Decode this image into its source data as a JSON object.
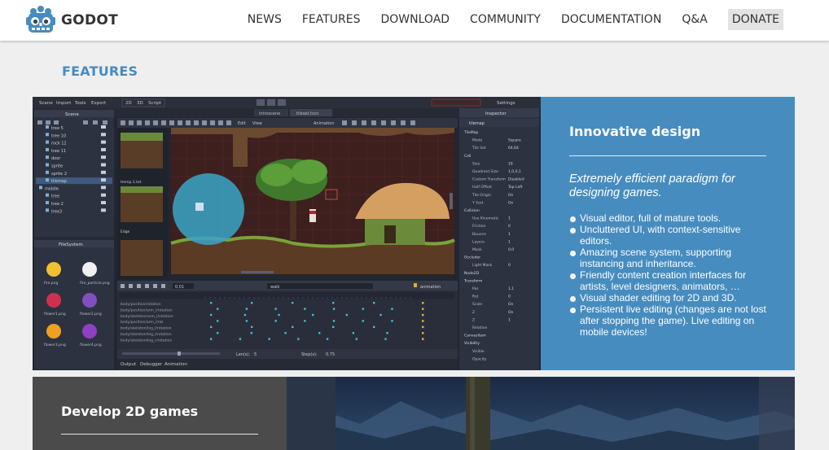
{
  "header": {
    "brand": "GODOT",
    "logo_icon": "godot-robot-logo-icon",
    "nav": [
      {
        "label": "NEWS"
      },
      {
        "label": "FEATURES"
      },
      {
        "label": "DOWNLOAD"
      },
      {
        "label": "COMMUNITY"
      },
      {
        "label": "DOCUMENTATION"
      },
      {
        "label": "Q&A"
      },
      {
        "label": "DONATE"
      }
    ]
  },
  "section": {
    "title": "FEATURES"
  },
  "feature1": {
    "title": "Innovative design",
    "tagline": "Extremely efficient paradigm for designing games.",
    "bullets": [
      "Visual editor, full of mature tools.",
      "Uncluttered UI, with context-sensitive editors.",
      "Amazing scene system, supporting instancing and inheritance.",
      "Friendly content creation interfaces for artists, level designers, animators, …",
      "Visual shader editing for 2D and 3D.",
      "Persistent live editing (changes are not lost after stopping the game). Live editing on mobile devices!"
    ],
    "screenshot": {
      "menu": [
        "Scene",
        "Import",
        "Tools",
        "Export"
      ],
      "modes": [
        "2D",
        "3D",
        "Script"
      ],
      "scene_tabs": [
        "introscene",
        "tileset.tscn"
      ],
      "settings": "Settings",
      "left_dock_title": "Scene",
      "tree": [
        "tree 5",
        "tree 10",
        "rock 12",
        "tree 11",
        "door",
        "sprite",
        "sprite 2",
        "tilemap",
        "middle",
        "tree",
        "tree 2",
        "tree3"
      ],
      "filesystem_title": "FileSystem",
      "files": [
        "fire.png",
        "fire_particle.png",
        "flower1.png",
        "flower2.png",
        "flower3.png",
        "flower4.png"
      ],
      "toolbar": [
        "Edit",
        "View",
        "Animation"
      ],
      "tile_labels": [
        "Hemp.1.tet",
        "Edge"
      ],
      "anim_toolbar": [
        "walk",
        "animation"
      ],
      "tracks": [
        "body/position/rotation",
        "body/position/arm_l/rotation",
        "body/skeleton/arm_l/rotation",
        "body/position/arm_l/rot",
        "body/skeleton/leg_l/rotation",
        "body/skeleton/leg_l/rotation",
        "body/skeleton/leg_r/rotation"
      ],
      "bottom_tabs": [
        "Output",
        "Debugger",
        "Animation"
      ],
      "len_label": "Len(s):",
      "len_value": "5",
      "step_label": "Step(s):",
      "step_value": "0.75",
      "frame_value": "0.01",
      "inspector_title": "Inspector",
      "inspector_node": "tilemap",
      "inspector_props": [
        "TileMap",
        "Mode",
        "Tile Set",
        "Cell",
        "Size",
        "Quadrant Size",
        "Custom Transform",
        "Half Offset",
        "Tile Origin",
        "Y Sort",
        "Collision",
        "Use Kinematic",
        "Friction",
        "Bounce",
        "Layers",
        "Mask",
        "Occluder",
        "Light Mask",
        "Node2D",
        "Transform",
        "Pos",
        "Rot",
        "Scale",
        "Z",
        "Z",
        "Relative",
        "CanvasItem",
        "Visibility",
        "Visible",
        "Opacity"
      ],
      "inspector_values": [
        "Square",
        "64,64",
        "16",
        "1,0,0,1",
        "Disabled",
        "Top Left",
        "On",
        "On",
        "1",
        "0",
        "1",
        "1",
        "0,0",
        "0",
        "1,1",
        "0",
        "On",
        "On",
        "1"
      ]
    }
  },
  "feature2": {
    "title": "Develop 2D games"
  },
  "colors": {
    "accent": "#478cbf",
    "dark_card": "#4b4b4b",
    "page_bg": "#efefef"
  }
}
